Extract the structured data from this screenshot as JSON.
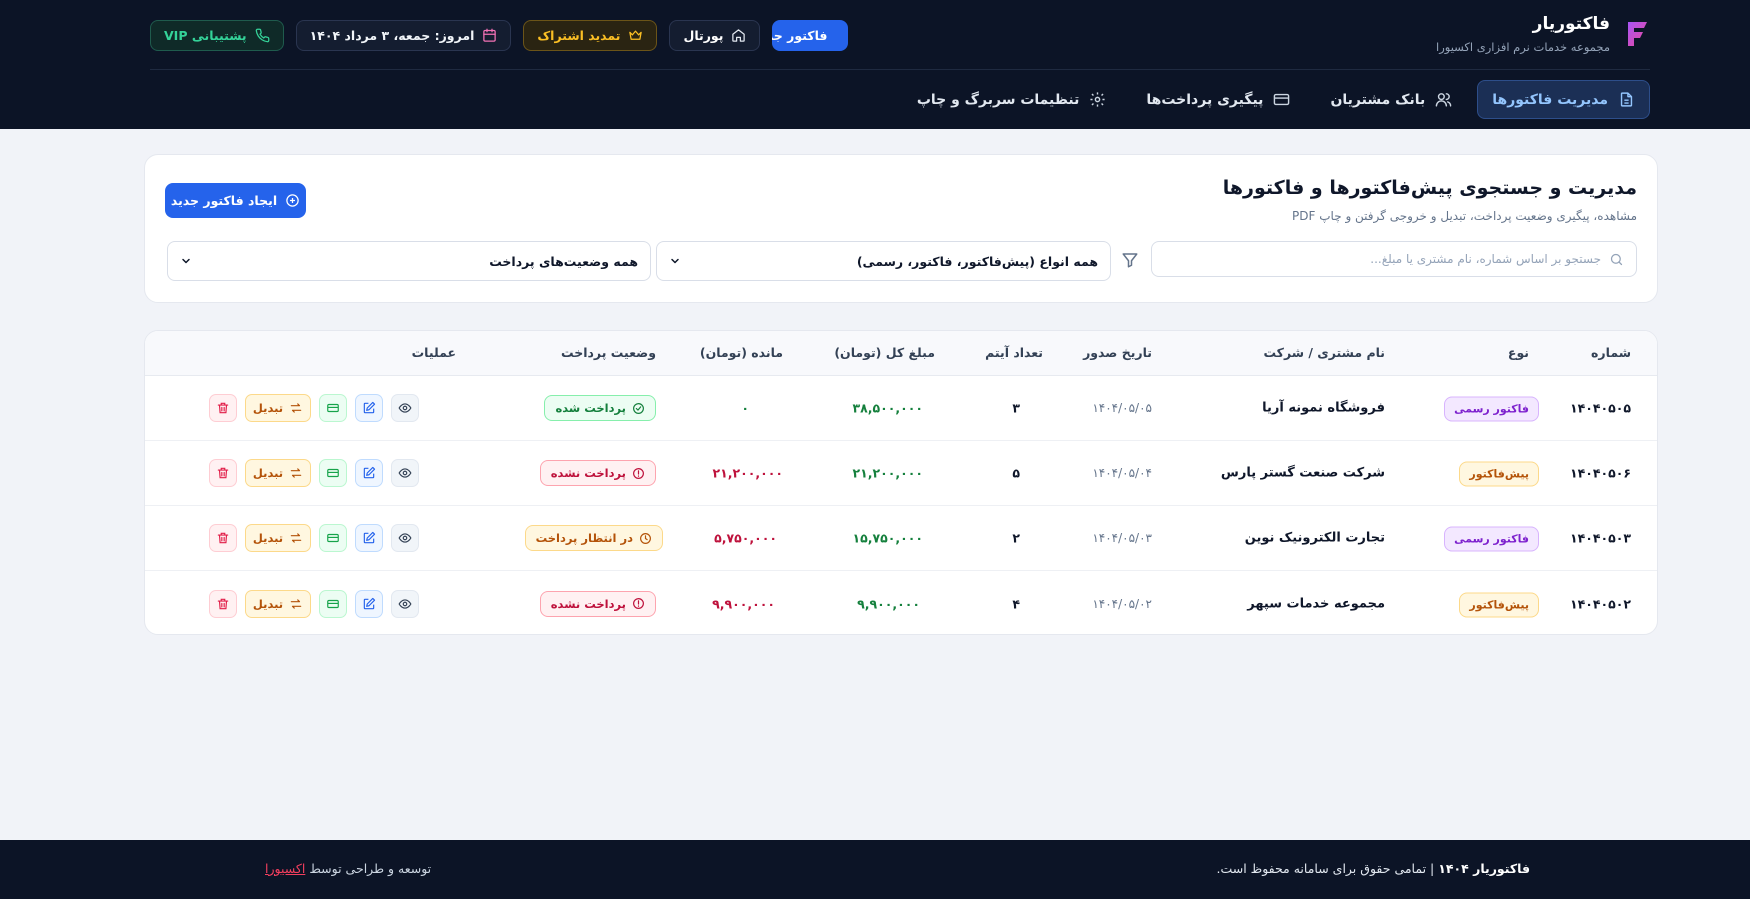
{
  "brand": {
    "title": "فاکتوریار",
    "subtitle": "مجموعه خدمات نرم افزاری اکسیورا"
  },
  "top": {
    "vip": "پشتیبانی VIP",
    "date": "امروز: جمعه، ۳ مرداد ۱۴۰۴",
    "subscription": "تمدید اشتراک",
    "portal": "پورتال",
    "factor": "فاکتور جدید"
  },
  "nav": [
    {
      "label": "مدیریت فاکتورها"
    },
    {
      "label": "بانک مشتریان"
    },
    {
      "label": "پیگیری پرداخت‌ها"
    },
    {
      "label": "تنظیمات سربرگ و چاپ"
    }
  ],
  "main": {
    "title": "مدیریت و جستجوی پیش‌فاکتورها و فاکتورها",
    "subtitle": "مشاهده، پیگیری وضعیت پرداخت، تبدیل و خروجی گرفتن و چاپ PDF",
    "new_button": "ایجاد فاکتور جدید",
    "search_placeholder": "جستجو بر اساس شماره، نام مشتری یا مبلغ...",
    "type_filter": "همه انواع (پیش‌فاکتور، فاکتور، رسمی)",
    "status_filter": "همه وضعیت‌های پرداخت"
  },
  "table": {
    "headers": {
      "number": "شماره",
      "type": "نوع",
      "customer": "نام مشتری / شرکت",
      "date": "تاریخ صدور",
      "items": "تعداد آیتم",
      "total": "مبلغ کل (تومان)",
      "remaining": "مانده (تومان)",
      "status": "وضعیت پرداخت",
      "ops": "عملیات"
    },
    "convert_label": "تبدیل",
    "rows": [
      {
        "number": "۱۴۰۴۰۵۰۵",
        "type": "فاکتور رسمی",
        "customer": "فروشگاه نمونه آریا",
        "date": "۱۴۰۴/۰۵/۰۵",
        "items": "۳",
        "total": "۳۸,۵۰۰,۰۰۰",
        "remaining": "۰",
        "status": "پرداخت شده"
      },
      {
        "number": "۱۴۰۴۰۵۰۶",
        "type": "پیش‌فاکتور",
        "customer": "شرکت صنعت گستر پارس",
        "date": "۱۴۰۴/۰۵/۰۴",
        "items": "۵",
        "total": "۲۱,۲۰۰,۰۰۰",
        "remaining": "۲۱,۲۰۰,۰۰۰",
        "status": "پرداخت نشده"
      },
      {
        "number": "۱۴۰۴۰۵۰۳",
        "type": "فاکتور رسمی",
        "customer": "تجارت الکترونیک نوین",
        "date": "۱۴۰۴/۰۵/۰۳",
        "items": "۲",
        "total": "۱۵,۷۵۰,۰۰۰",
        "remaining": "۵,۷۵۰,۰۰۰",
        "status": "در انتظار پرداخت"
      },
      {
        "number": "۱۴۰۴۰۵۰۲",
        "type": "پیش‌فاکتور",
        "customer": "مجموعه خدمات سپهر",
        "date": "۱۴۰۴/۰۵/۰۲",
        "items": "۴",
        "total": "۹,۹۰۰,۰۰۰",
        "remaining": "۹,۹۰۰,۰۰۰",
        "status": "پرداخت نشده"
      }
    ]
  },
  "footer": {
    "copyright_brand": "فاکتوریار ۱۴۰۴",
    "copyright_text": "| تمامی حقوق برای سامانه محفوظ است.",
    "credit_text": "توسعه و طراحی توسط",
    "credit_link": "اکسیورا"
  },
  "colors": {
    "accent": "#2563eb",
    "header_bg": "#0c1426",
    "paid": "#15803d",
    "due": "#be123c",
    "pending": "#b45309"
  }
}
